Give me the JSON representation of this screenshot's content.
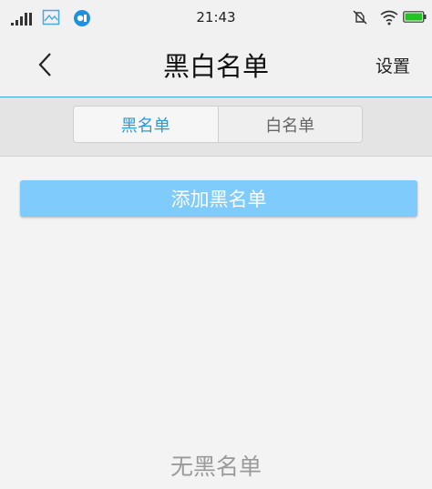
{
  "status_bar": {
    "time": "21:43",
    "icons": [
      "signal-icon",
      "gallery-icon",
      "app-notification-icon",
      "mute-icon",
      "wifi-icon",
      "battery-icon"
    ],
    "accent_color": "#1e90e0",
    "battery_color": "#21c421"
  },
  "header": {
    "back_icon": "chevron-left-icon",
    "title": "黑白名单",
    "settings_label": "设置"
  },
  "tabs": {
    "items": [
      {
        "label": "黑名单",
        "selected": true
      },
      {
        "label": "白名单",
        "selected": false
      }
    ],
    "active_color": "#2c9ad6"
  },
  "main": {
    "add_button_label": "添加黑名单",
    "add_button_color": "#7fcbfb",
    "empty_text": "无黑名单"
  }
}
